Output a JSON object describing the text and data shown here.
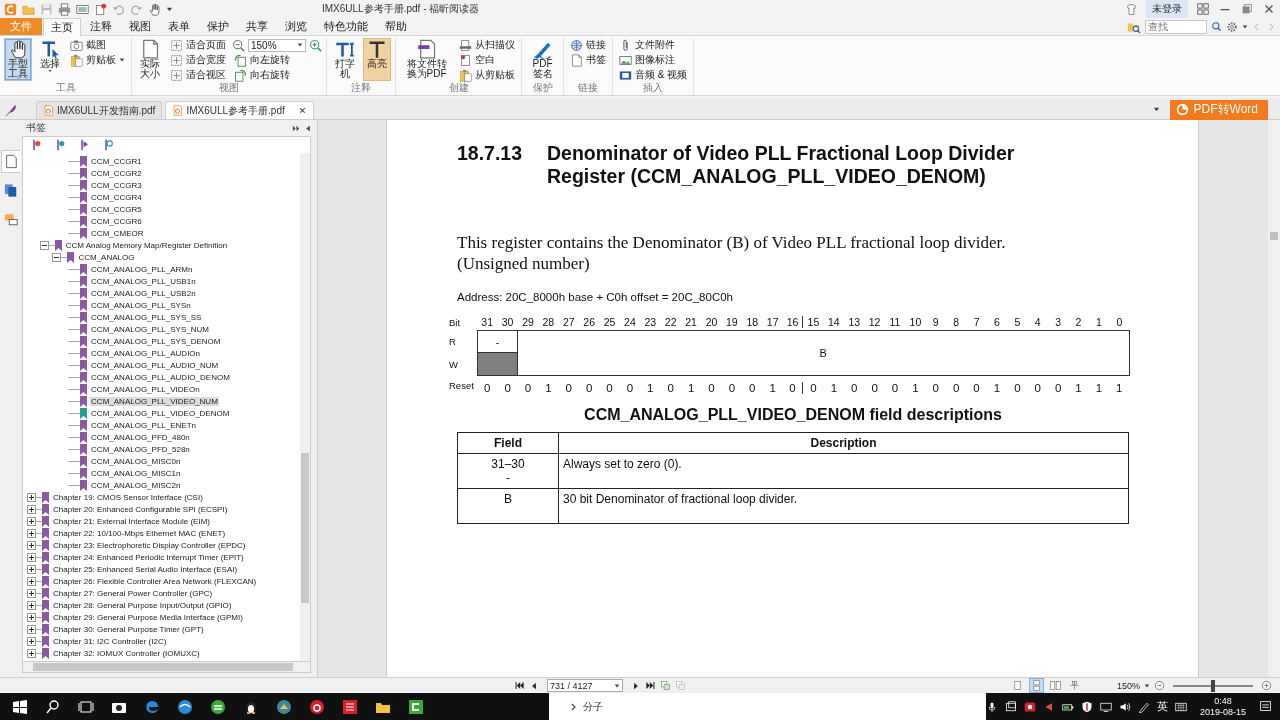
{
  "window": {
    "title": "IMX6ULL参考手册.pdf - 福昕阅读器",
    "account": "未登录"
  },
  "menu_tabs": [
    {
      "label": "文件",
      "kind": "file",
      "selected": false
    },
    {
      "label": "主页",
      "kind": "tab",
      "selected": true
    },
    {
      "label": "注释",
      "kind": "tab",
      "selected": false
    },
    {
      "label": "视图",
      "kind": "tab",
      "selected": false
    },
    {
      "label": "表单",
      "kind": "tab",
      "selected": false
    },
    {
      "label": "保护",
      "kind": "tab",
      "selected": false
    },
    {
      "label": "共享",
      "kind": "tab",
      "selected": false
    },
    {
      "label": "浏览",
      "kind": "tab",
      "selected": false
    },
    {
      "label": "特色功能",
      "kind": "tab",
      "selected": false
    },
    {
      "label": "帮助",
      "kind": "tab",
      "selected": false
    }
  ],
  "search": {
    "placeholder": "查找"
  },
  "ribbon": {
    "groups": [
      {
        "title": "工具",
        "columns": [
          {
            "kind": "large",
            "label": "手型工具",
            "selected": true,
            "hovered": false,
            "menu": false
          },
          {
            "kind": "large",
            "label": "选择",
            "selected": false,
            "hovered": false,
            "menu": true
          },
          {
            "kind": "stack",
            "items": [
              {
                "kind": "button",
                "label": "截图",
                "menu": false
              },
              {
                "kind": "button",
                "label": "剪贴板",
                "menu": true
              }
            ]
          }
        ]
      },
      {
        "title": "视图",
        "columns": [
          {
            "kind": "large",
            "label": "实际大小",
            "selected": false,
            "hovered": false,
            "menu": false
          },
          {
            "kind": "stack",
            "items": [
              {
                "kind": "button",
                "label": "适合页面",
                "menu": false
              },
              {
                "kind": "button",
                "label": "适合宽度",
                "menu": false
              },
              {
                "kind": "button",
                "label": "适合视区",
                "menu": false
              }
            ]
          },
          {
            "kind": "stack",
            "items": [
              {
                "kind": "zoom",
                "value": "150%"
              },
              {
                "kind": "button",
                "label": "向左旋转",
                "menu": false
              },
              {
                "kind": "button",
                "label": "向右旋转",
                "menu": false
              }
            ]
          }
        ]
      },
      {
        "title": "注释",
        "columns": [
          {
            "kind": "large",
            "label": "打字机",
            "selected": false,
            "hovered": false,
            "menu": false
          },
          {
            "kind": "large",
            "label": "高亮",
            "selected": false,
            "hovered": true,
            "menu": false
          }
        ]
      },
      {
        "title": "创建",
        "columns": [
          {
            "kind": "large",
            "label": "将文件转换为PDF",
            "selected": false,
            "hovered": false,
            "menu": false
          },
          {
            "kind": "stack",
            "items": [
              {
                "kind": "button",
                "label": "从扫描仪",
                "menu": false
              },
              {
                "kind": "button",
                "label": "空白",
                "menu": false
              },
              {
                "kind": "button",
                "label": "从剪贴板",
                "menu": false
              }
            ]
          }
        ]
      },
      {
        "title": "保护",
        "columns": [
          {
            "kind": "large",
            "label": "PDF签名",
            "selected": false,
            "hovered": false,
            "menu": false
          }
        ]
      },
      {
        "title": "链接",
        "columns": [
          {
            "kind": "stack",
            "items": [
              {
                "kind": "button",
                "label": "链接",
                "menu": false
              },
              {
                "kind": "button",
                "label": "书签",
                "menu": false
              }
            ]
          }
        ]
      },
      {
        "title": "插入",
        "columns": [
          {
            "kind": "stack",
            "items": [
              {
                "kind": "button",
                "label": "文件附件",
                "menu": false
              },
              {
                "kind": "button",
                "label": "图像标注",
                "menu": false
              },
              {
                "kind": "button",
                "label": "音频 & 视频",
                "menu": false
              }
            ]
          }
        ]
      }
    ]
  },
  "doc_tabs": [
    {
      "label": "IMX6ULL开发指南.pdf",
      "selected": false
    },
    {
      "label": "IMX6ULL参考手册.pdf",
      "selected": true
    }
  ],
  "pdf_to_word": "PDF转Word",
  "sidebar": {
    "title": "书签",
    "panels": [
      {
        "selected": true
      },
      {
        "selected": false
      },
      {
        "selected": false
      }
    ],
    "tree": [
      {
        "children": [
          {
            "children": [
              {
                "children": [
                  {
                    "label": "CCM_CCGR1",
                    "selected": false,
                    "current": false
                  },
                  {
                    "label": "CCM_CCGR2",
                    "selected": false,
                    "current": false
                  },
                  {
                    "label": "CCM_CCGR3",
                    "selected": false,
                    "current": false
                  },
                  {
                    "label": "CCM_CCGR4",
                    "selected": false,
                    "current": false
                  },
                  {
                    "label": "CCM_CCGR5",
                    "selected": false,
                    "current": false
                  },
                  {
                    "label": "CCM_CCGR6",
                    "selected": false,
                    "current": false
                  },
                  {
                    "label": "CCM_CMEOR",
                    "selected": false,
                    "current": false
                  }
                ]
              }
            ]
          },
          {
            "label": "CCM Analog Memory Map/Register Definition",
            "expanded": true,
            "selected": false,
            "current": false,
            "children": [
              {
                "label": "CCM_ANALOG",
                "expanded": true,
                "selected": false,
                "current": false,
                "children": [
                  {
                    "label": "CCM_ANALOG_PLL_ARMn",
                    "selected": false,
                    "current": false
                  },
                  {
                    "label": "CCM_ANALOG_PLL_USB1n",
                    "selected": false,
                    "current": false
                  },
                  {
                    "label": "CCM_ANALOG_PLL_USB2n",
                    "selected": false,
                    "current": false
                  },
                  {
                    "label": "CCM_ANALOG_PLL_SYSn",
                    "selected": false,
                    "current": false
                  },
                  {
                    "label": "CCM_ANALOG_PLL_SYS_SS",
                    "selected": false,
                    "current": false
                  },
                  {
                    "label": "CCM_ANALOG_PLL_SYS_NUM",
                    "selected": false,
                    "current": false
                  },
                  {
                    "label": "CCM_ANALOG_PLL_SYS_DENOM",
                    "selected": false,
                    "current": false
                  },
                  {
                    "label": "CCM_ANALOG_PLL_AUDIOn",
                    "selected": false,
                    "current": false
                  },
                  {
                    "label": "CCM_ANALOG_PLL_AUDIO_NUM",
                    "selected": false,
                    "current": false
                  },
                  {
                    "label": "CCM_ANALOG_PLL_AUDIO_DENOM",
                    "selected": false,
                    "current": false
                  },
                  {
                    "label": "CCM_ANALOG_PLL_VIDEOn",
                    "selected": false,
                    "current": false
                  },
                  {
                    "label": "CCM_ANALOG_PLL_VIDEO_NUM",
                    "selected": true,
                    "current": false
                  },
                  {
                    "label": "CCM_ANALOG_PLL_VIDEO_DENOM",
                    "selected": false,
                    "current": true
                  },
                  {
                    "label": "CCM_ANALOG_PLL_ENETn",
                    "selected": false,
                    "current": false
                  },
                  {
                    "label": "CCM_ANALOG_PFD_480n",
                    "selected": false,
                    "current": false
                  },
                  {
                    "label": "CCM_ANALOG_PFD_528n",
                    "selected": false,
                    "current": false
                  },
                  {
                    "label": "CCM_ANALOG_MISC0n",
                    "selected": false,
                    "current": false
                  },
                  {
                    "label": "CCM_ANALOG_MISC1n",
                    "selected": false,
                    "current": false
                  },
                  {
                    "label": "CCM_ANALOG_MISC2n",
                    "selected": false,
                    "current": false
                  }
                ]
              }
            ]
          }
        ]
      },
      {
        "label": "Chapter 19: CMOS Sensor Interface (CSI)",
        "expanded": false,
        "selected": false,
        "current": false
      },
      {
        "label": "Chapter 20: Enhanced Configurable SPI (ECSPI)",
        "expanded": false,
        "selected": false,
        "current": false
      },
      {
        "label": "Chapter 21: External Interface Module (EIM)",
        "expanded": false,
        "selected": false,
        "current": false
      },
      {
        "label": "Chapter 22: 10/100-Mbps Ethernet MAC (ENET)",
        "expanded": false,
        "selected": false,
        "current": false
      },
      {
        "label": "Chapter 23: Electrophoretic Display Controller (EPDC)",
        "expanded": false,
        "selected": false,
        "current": false
      },
      {
        "label": "Chapter 24: Enhanced Periodic Interrupt Timer (EPIT)",
        "expanded": false,
        "selected": false,
        "current": false
      },
      {
        "label": "Chapter 25: Enhanced Serial Audio Interface (ESAI)",
        "expanded": false,
        "selected": false,
        "current": false
      },
      {
        "label": "Chapter 26: Flexible Controller Area Network (FLEXCAN)",
        "expanded": false,
        "selected": false,
        "current": false
      },
      {
        "label": "Chapter 27: General Power Controller (GPC)",
        "expanded": false,
        "selected": false,
        "current": false
      },
      {
        "label": "Chapter 28: General Purpose Input/Output (GPIO)",
        "expanded": false,
        "selected": false,
        "current": false
      },
      {
        "label": "Chapter 29: General Purpose Media Interface (GPMI)",
        "expanded": false,
        "selected": false,
        "current": false
      },
      {
        "label": "Chapter 30: General Purpose Timer (GPT)",
        "expanded": false,
        "selected": false,
        "current": false
      },
      {
        "label": "Chapter 31: I2C Controller (I2C)",
        "expanded": false,
        "selected": false,
        "current": false
      },
      {
        "label": "Chapter 32: IOMUX Controller (IOMUXC)",
        "expanded": false,
        "selected": false,
        "current": false
      }
    ]
  },
  "document": {
    "section_number": "18.7.13",
    "section_title": "Denominator of Video PLL Fractional Loop Divider Register (CCM_ANALOG_PLL_VIDEO_DENOM)",
    "paragraph": "This register contains the Denominator (B) of Video PLL fractional loop divider. (Unsigned number)",
    "address": "Address: 20C_8000h base + C0h offset = 20C_80C0h",
    "register": {
      "bit_label": "Bit",
      "read_label": "R",
      "write_label": "W",
      "reset_label": "Reset",
      "bits": [
        "31",
        "30",
        "29",
        "28",
        "27",
        "26",
        "25",
        "24",
        "23",
        "22",
        "21",
        "20",
        "19",
        "18",
        "17",
        "16",
        "15",
        "14",
        "13",
        "12",
        "11",
        "10",
        "9",
        "8",
        "7",
        "6",
        "5",
        "4",
        "3",
        "2",
        "1",
        "0"
      ],
      "fields": [
        {
          "kind": "reserved",
          "read": "-"
        },
        {
          "kind": "field",
          "name": "B"
        }
      ],
      "reset": [
        "0",
        "0",
        "0",
        "1",
        "0",
        "0",
        "0",
        "0",
        "1",
        "0",
        "1",
        "0",
        "0",
        "0",
        "1",
        "0",
        "0",
        "1",
        "0",
        "0",
        "0",
        "1",
        "0",
        "0",
        "0",
        "1",
        "0",
        "0",
        "0",
        "1",
        "1",
        "1"
      ]
    },
    "table_caption": "CCM_ANALOG_PLL_VIDEO_DENOM field descriptions",
    "table": {
      "columns": [
        "Field",
        "Description"
      ],
      "rows": [
        {
          "field": [
            "31–30",
            "-"
          ],
          "description": "Always set to zero (0)."
        },
        {
          "field": [
            "B"
          ],
          "description": "30 bit Denominator of fractional loop divider."
        }
      ]
    }
  },
  "status_bar": {
    "page": "731 / 4127",
    "view_modes": [
      {
        "selected": false
      },
      {
        "selected": true
      },
      {
        "selected": false
      },
      {
        "selected": false
      }
    ],
    "zoom": "150%",
    "zoom_slider": {
      "level": 0.5
    }
  },
  "taskbar": {
    "popup": "分子",
    "input_language": "英",
    "time": "0:48",
    "date": "2019-08-15"
  }
}
